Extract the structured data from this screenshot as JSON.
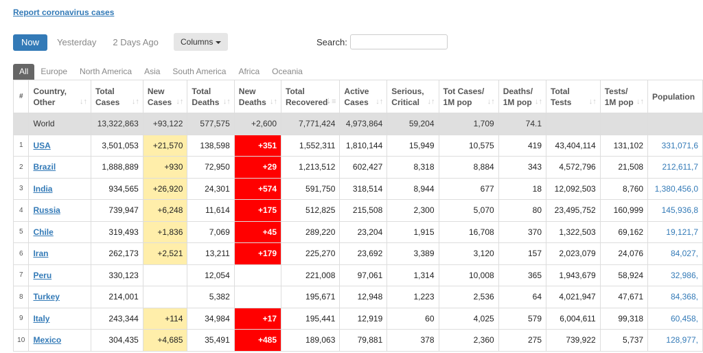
{
  "report_link": "Report coronavirus cases",
  "day_tabs": [
    "Now",
    "Yesterday",
    "2 Days Ago"
  ],
  "columns_button": "Columns",
  "search": {
    "label": "Search:",
    "value": "",
    "placeholder": ""
  },
  "region_tabs": [
    "All",
    "Europe",
    "North America",
    "Asia",
    "South America",
    "Africa",
    "Oceania"
  ],
  "headers": [
    {
      "line1": "#",
      "line2": ""
    },
    {
      "line1": "Country,",
      "line2": "Other"
    },
    {
      "line1": "Total",
      "line2": "Cases"
    },
    {
      "line1": "New",
      "line2": "Cases"
    },
    {
      "line1": "Total",
      "line2": "Deaths"
    },
    {
      "line1": "New",
      "line2": "Deaths"
    },
    {
      "line1": "Total",
      "line2": "Recovered"
    },
    {
      "line1": "Active",
      "line2": "Cases"
    },
    {
      "line1": "Serious,",
      "line2": "Critical"
    },
    {
      "line1": "Tot Cases/",
      "line2": "1M pop"
    },
    {
      "line1": "Deaths/",
      "line2": "1M pop"
    },
    {
      "line1": "Total",
      "line2": "Tests"
    },
    {
      "line1": "Tests/",
      "line2": "1M pop"
    },
    {
      "line1": "Population",
      "line2": ""
    }
  ],
  "world": {
    "num": "",
    "country": "World",
    "total_cases": "13,322,863",
    "new_cases": "+93,122",
    "total_deaths": "577,575",
    "new_deaths": "+2,600",
    "total_recovered": "7,771,424",
    "active_cases": "4,973,864",
    "serious": "59,204",
    "cases_per_m": "1,709",
    "deaths_per_m": "74.1",
    "total_tests": "",
    "tests_per_m": "",
    "population": ""
  },
  "rows": [
    {
      "num": "1",
      "country": "USA",
      "total_cases": "3,501,053",
      "new_cases": "+21,570",
      "total_deaths": "138,598",
      "new_deaths": "+351",
      "total_recovered": "1,552,311",
      "active_cases": "1,810,144",
      "serious": "15,949",
      "cases_per_m": "10,575",
      "deaths_per_m": "419",
      "total_tests": "43,404,114",
      "tests_per_m": "131,102",
      "population": "331,071,6"
    },
    {
      "num": "2",
      "country": "Brazil",
      "total_cases": "1,888,889",
      "new_cases": "+930",
      "total_deaths": "72,950",
      "new_deaths": "+29",
      "total_recovered": "1,213,512",
      "active_cases": "602,427",
      "serious": "8,318",
      "cases_per_m": "8,884",
      "deaths_per_m": "343",
      "total_tests": "4,572,796",
      "tests_per_m": "21,508",
      "population": "212,611,7"
    },
    {
      "num": "3",
      "country": "India",
      "total_cases": "934,565",
      "new_cases": "+26,920",
      "total_deaths": "24,301",
      "new_deaths": "+574",
      "total_recovered": "591,750",
      "active_cases": "318,514",
      "serious": "8,944",
      "cases_per_m": "677",
      "deaths_per_m": "18",
      "total_tests": "12,092,503",
      "tests_per_m": "8,760",
      "population": "1,380,456,0"
    },
    {
      "num": "4",
      "country": "Russia",
      "total_cases": "739,947",
      "new_cases": "+6,248",
      "total_deaths": "11,614",
      "new_deaths": "+175",
      "total_recovered": "512,825",
      "active_cases": "215,508",
      "serious": "2,300",
      "cases_per_m": "5,070",
      "deaths_per_m": "80",
      "total_tests": "23,495,752",
      "tests_per_m": "160,999",
      "population": "145,936,8"
    },
    {
      "num": "5",
      "country": "Chile",
      "total_cases": "319,493",
      "new_cases": "+1,836",
      "total_deaths": "7,069",
      "new_deaths": "+45",
      "total_recovered": "289,220",
      "active_cases": "23,204",
      "serious": "1,915",
      "cases_per_m": "16,708",
      "deaths_per_m": "370",
      "total_tests": "1,322,503",
      "tests_per_m": "69,162",
      "population": "19,121,7"
    },
    {
      "num": "6",
      "country": "Iran",
      "total_cases": "262,173",
      "new_cases": "+2,521",
      "total_deaths": "13,211",
      "new_deaths": "+179",
      "total_recovered": "225,270",
      "active_cases": "23,692",
      "serious": "3,389",
      "cases_per_m": "3,120",
      "deaths_per_m": "157",
      "total_tests": "2,023,079",
      "tests_per_m": "24,076",
      "population": "84,027,"
    },
    {
      "num": "7",
      "country": "Peru",
      "total_cases": "330,123",
      "new_cases": "",
      "total_deaths": "12,054",
      "new_deaths": "",
      "total_recovered": "221,008",
      "active_cases": "97,061",
      "serious": "1,314",
      "cases_per_m": "10,008",
      "deaths_per_m": "365",
      "total_tests": "1,943,679",
      "tests_per_m": "58,924",
      "population": "32,986,"
    },
    {
      "num": "8",
      "country": "Turkey",
      "total_cases": "214,001",
      "new_cases": "",
      "total_deaths": "5,382",
      "new_deaths": "",
      "total_recovered": "195,671",
      "active_cases": "12,948",
      "serious": "1,223",
      "cases_per_m": "2,536",
      "deaths_per_m": "64",
      "total_tests": "4,021,947",
      "tests_per_m": "47,671",
      "population": "84,368,"
    },
    {
      "num": "9",
      "country": "Italy",
      "total_cases": "243,344",
      "new_cases": "+114",
      "total_deaths": "34,984",
      "new_deaths": "+17",
      "total_recovered": "195,441",
      "active_cases": "12,919",
      "serious": "60",
      "cases_per_m": "4,025",
      "deaths_per_m": "579",
      "total_tests": "6,004,611",
      "tests_per_m": "99,318",
      "population": "60,458,"
    },
    {
      "num": "10",
      "country": "Mexico",
      "total_cases": "304,435",
      "new_cases": "+4,685",
      "total_deaths": "35,491",
      "new_deaths": "+485",
      "total_recovered": "189,063",
      "active_cases": "79,881",
      "serious": "378",
      "cases_per_m": "2,360",
      "deaths_per_m": "275",
      "total_tests": "739,922",
      "tests_per_m": "5,737",
      "population": "128,977,"
    }
  ],
  "colors": {
    "accent": "#337ab7",
    "new_cases_bg": "#ffeeaa",
    "new_deaths_bg": "#ff0000",
    "world_bg": "#dfdfdf"
  }
}
